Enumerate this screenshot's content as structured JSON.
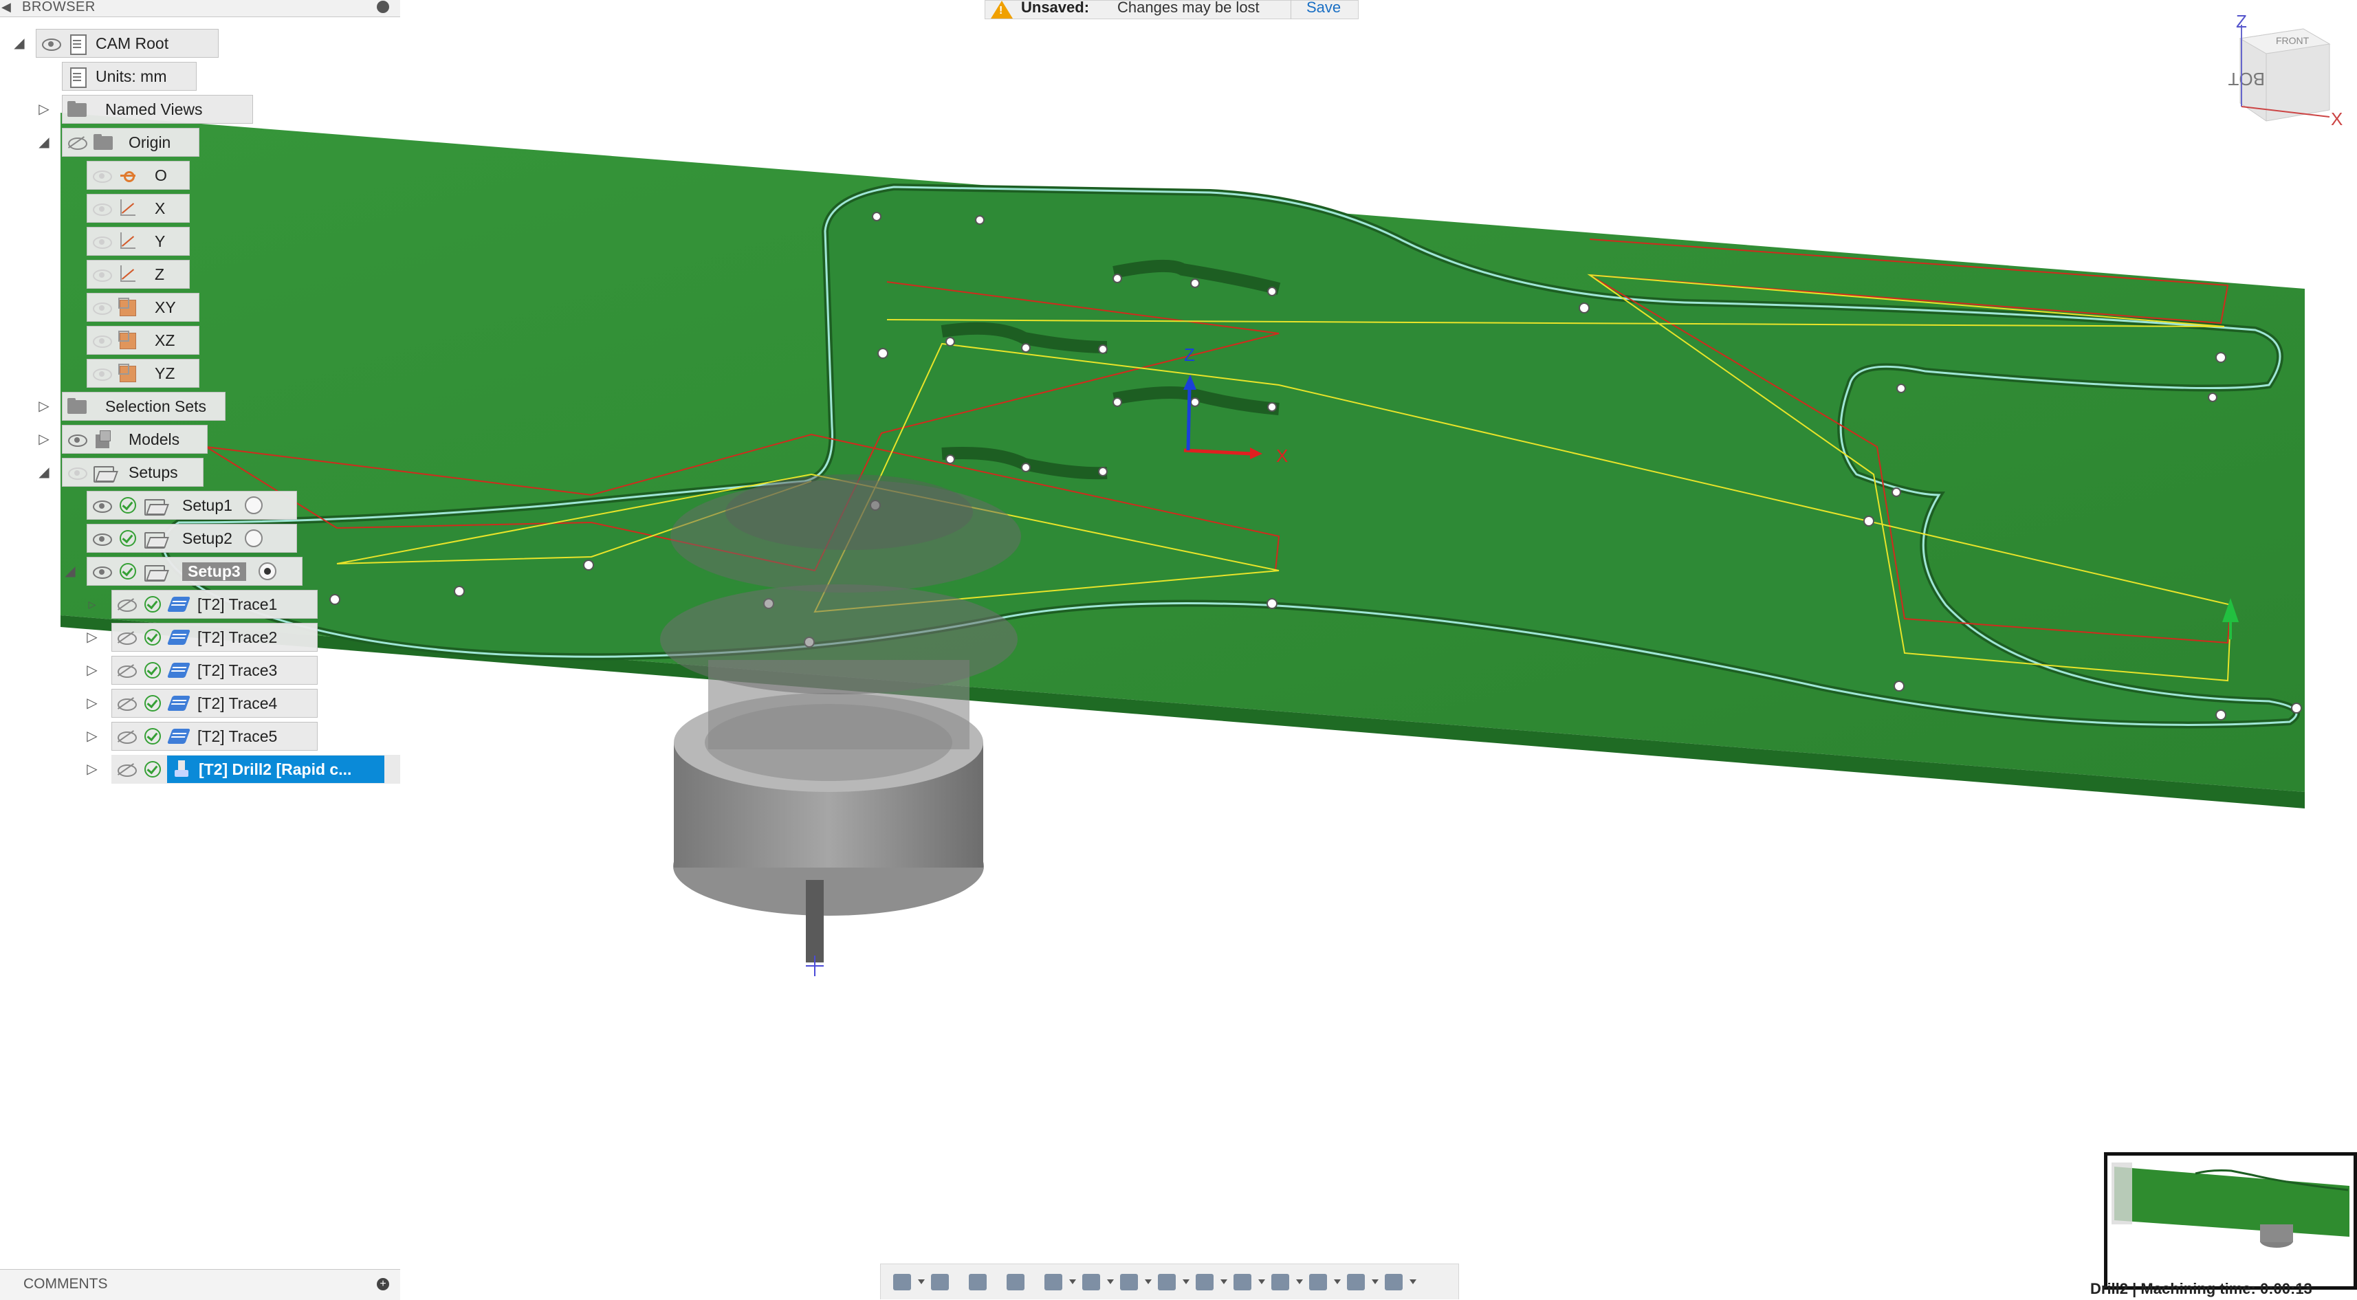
{
  "browser": {
    "title": "BROWSER",
    "tree": {
      "cam_root": "CAM Root",
      "units": "Units: mm",
      "named_views": "Named Views",
      "origin": "Origin",
      "origin_items": [
        "O",
        "X",
        "Y",
        "Z",
        "XY",
        "XZ",
        "YZ"
      ],
      "selection_sets": "Selection Sets",
      "models": "Models",
      "setups": "Setups",
      "setup_items": [
        "Setup1",
        "Setup2",
        "Setup3"
      ],
      "operations": [
        "[T2] Trace1",
        "[T2] Trace2",
        "[T2] Trace3",
        "[T2] Trace4",
        "[T2] Trace5",
        "[T2] Drill2 [Rapid c..."
      ]
    }
  },
  "notification": {
    "label": "Unsaved:",
    "message": "Changes may be lost",
    "save": "Save"
  },
  "viewcube": {
    "face_top": "FRONT",
    "face_main": "BOTTOM",
    "axis_z": "Z",
    "axis_x": "X"
  },
  "triad": {
    "z": "Z",
    "x": "X"
  },
  "comments": {
    "title": "COMMENTS"
  },
  "status": {
    "text": "Drill2 | Machining time: 0:00:13"
  },
  "icons": {
    "navbar": [
      "orbit-icon",
      "look-at-icon",
      "pan-icon",
      "zoom-icon",
      "zoom-window-icon",
      "display-settings-icon",
      "grid-icon",
      "view-icon",
      "section-icon",
      "orbit-mode-icon",
      "environment-icon",
      "effects-icon",
      "tool-icon",
      "simulate-icon"
    ]
  },
  "colors": {
    "stock": "#2f8c2f",
    "stock_side": "#1f6b24",
    "toolpath_red": "#d02b1d",
    "toolpath_yellow": "#e8e42a",
    "contour": "#9fe6d6",
    "selected": "#0a8ad8"
  }
}
